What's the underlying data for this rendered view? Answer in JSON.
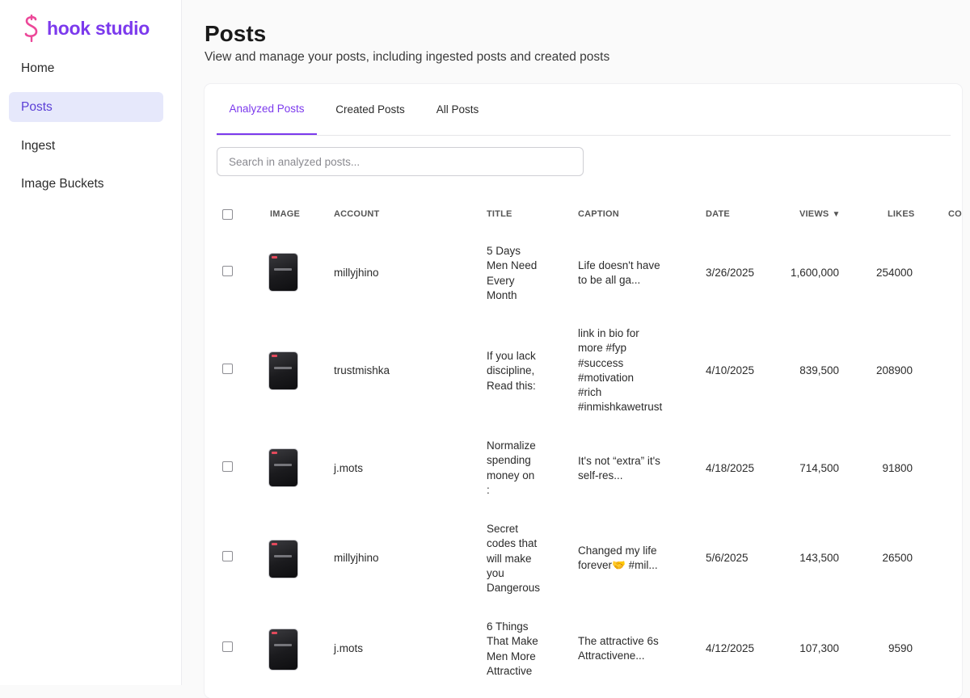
{
  "app": {
    "name": "hook studio"
  },
  "sidebar": {
    "items": [
      {
        "label": "Home"
      },
      {
        "label": "Posts"
      },
      {
        "label": "Ingest"
      },
      {
        "label": "Image Buckets"
      }
    ],
    "active": "Posts"
  },
  "page": {
    "title": "Posts",
    "subtitle": "View and manage your posts, including ingested posts and created posts"
  },
  "tabs": [
    {
      "label": "Analyzed Posts"
    },
    {
      "label": "Created Posts"
    },
    {
      "label": "All Posts"
    }
  ],
  "search": {
    "placeholder": "Search in analyzed posts...",
    "value": ""
  },
  "table": {
    "headers": {
      "image": "IMAGE",
      "account": "ACCOUNT",
      "title": "TITLE",
      "caption": "CAPTION",
      "date": "DATE",
      "views": "VIEWS",
      "likes": "LIKES",
      "comments": "CO"
    },
    "sort": {
      "column": "views",
      "direction": "desc",
      "indicator": "▼"
    },
    "rows": [
      {
        "account": "millyjhino",
        "title": [
          "5 Days",
          "Men Need",
          "Every",
          "Month"
        ],
        "caption": [
          "Life doesn't have",
          "to be all ga..."
        ],
        "date": "3/26/2025",
        "views": "1,600,000",
        "likes": "254000"
      },
      {
        "account": "trustmishka",
        "title": [
          "If you lack",
          "discipline,",
          "Read this:"
        ],
        "caption": [
          "link in bio for",
          "more #fyp",
          "#success",
          "#motivation",
          "#rich",
          "#inmishkawetrust"
        ],
        "date": "4/10/2025",
        "views": "839,500",
        "likes": "208900"
      },
      {
        "account": "j.mots",
        "title": [
          "Normalize",
          "spending",
          "money on",
          ":"
        ],
        "caption": [
          "It's not “extra” it's",
          "self-res..."
        ],
        "date": "4/18/2025",
        "views": "714,500",
        "likes": "91800"
      },
      {
        "account": "millyjhino",
        "title": [
          "Secret",
          "codes that",
          "will make",
          "you",
          "Dangerous"
        ],
        "caption": [
          "Changed my life",
          "forever🤝 #mil..."
        ],
        "date": "5/6/2025",
        "views": "143,500",
        "likes": "26500"
      },
      {
        "account": "j.mots",
        "title": [
          "6 Things",
          "That Make",
          "Men More",
          "Attractive"
        ],
        "caption": [
          "The attractive 6s",
          "Attractivene..."
        ],
        "date": "4/12/2025",
        "views": "107,300",
        "likes": "9590"
      }
    ]
  },
  "colors": {
    "accent": "#7c3aed",
    "active_nav_bg": "#e6e8fb",
    "logo_icon": "#ec4899"
  }
}
